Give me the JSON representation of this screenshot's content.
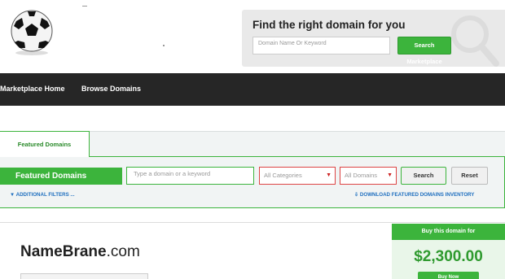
{
  "header": {
    "finder_title": "Find the right domain for you",
    "search_placeholder": "Domain Name Or Keyword",
    "search_button": "Search Marketplace"
  },
  "nav": {
    "items": [
      {
        "label": "Marketplace Home"
      },
      {
        "label": "Browse Domains"
      }
    ]
  },
  "featured": {
    "tab_label": "Featured Domains",
    "bar_label": "Featured Domains",
    "input_placeholder": "Type a domain or a keyword",
    "category_select": "All Categories",
    "domain_select": "All Domains",
    "search_button": "Search",
    "reset_button": "Reset",
    "filters_link": "▼ ADDITIONAL FILTERS ...",
    "download_link": "DOWNLOAD FEATURED DOMAINS INVENTORY"
  },
  "listing": {
    "domain_bold": "NameBrane",
    "domain_tld": ".com",
    "buy_heading": "Buy this domain for",
    "price": "$2,300.00",
    "buy_button": "Buy Now"
  },
  "colors": {
    "accent": "#3cb43c",
    "nav_bg": "#262626",
    "link": "#1f6fbf"
  }
}
